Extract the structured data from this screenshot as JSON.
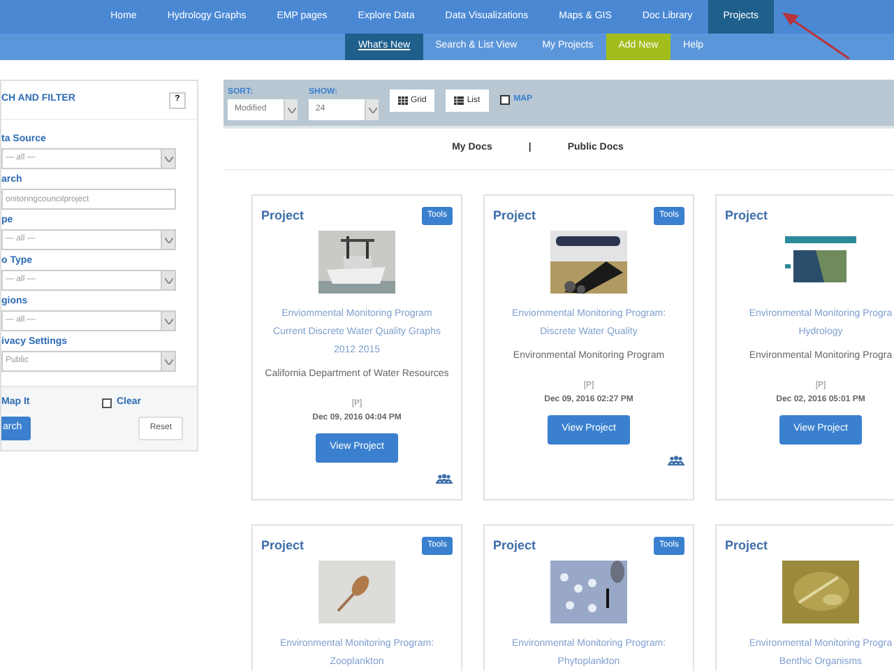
{
  "nav": [
    {
      "label": "Home",
      "selected": false
    },
    {
      "label": "Hydrology Graphs",
      "selected": false
    },
    {
      "label": "EMP pages",
      "selected": false
    },
    {
      "label": "Explore Data",
      "selected": false
    },
    {
      "label": "Data Visualizations",
      "selected": false
    },
    {
      "label": "Maps & GIS",
      "selected": false
    },
    {
      "label": "Doc Library",
      "selected": false
    },
    {
      "label": "Projects",
      "selected": true
    }
  ],
  "subnav": [
    {
      "label": "What's New",
      "selected": true,
      "kind": "link"
    },
    {
      "label": "Search & List View",
      "selected": false,
      "kind": "link"
    },
    {
      "label": "My Projects",
      "selected": false,
      "kind": "link"
    },
    {
      "label": "Add New",
      "selected": false,
      "kind": "highlight"
    },
    {
      "label": "Help",
      "selected": false,
      "kind": "link"
    }
  ],
  "sidebar": {
    "title": "CH AND FILTER",
    "help": "?",
    "fields": [
      {
        "label": "ta Source",
        "kind": "select",
        "value": "— all —"
      },
      {
        "label": "arch",
        "kind": "input",
        "value": "onitoringcouncilproject"
      },
      {
        "label": "pe",
        "kind": "select",
        "value": "— all —"
      },
      {
        "label": "o Type",
        "kind": "select",
        "value": "— all —"
      },
      {
        "label": "gions",
        "kind": "select",
        "value": "— all —"
      },
      {
        "label": "ivacy Settings",
        "kind": "select",
        "value": "Public"
      }
    ],
    "map_it": "Map It",
    "clear": {
      "label": "Clear",
      "checked": false
    },
    "search_button": "arch",
    "reset_button": "Reset"
  },
  "toolbar": {
    "sort_label": "SORT:",
    "sort_value": "Modified",
    "show_label": "SHOW:",
    "show_value": "24",
    "grid_button": "Grid",
    "list_button": "List",
    "map": {
      "label": "MAP",
      "checked": false
    }
  },
  "doc_tabs": [
    "My Docs",
    "|",
    "Public Docs"
  ],
  "cards": [
    {
      "type": "Project",
      "tools": "Tools",
      "title": "Enviommental Monitoring Program\nCurrent Discrete Water Quality Graphs\n2012 2015",
      "org": "California Department of Water Resources",
      "privacy": "[P]",
      "date": "Dec 09, 2016 04:04 PM",
      "button": "View Project",
      "shared": true
    },
    {
      "type": "Project",
      "tools": "Tools",
      "title": "Enviornmental Monitoring Program:\nDiscrete Water Quality",
      "org": "Environmental Monitoring Program",
      "privacy": "[P]",
      "date": "Dec 09, 2016 02:27 PM",
      "button": "View Project",
      "shared": true
    },
    {
      "type": "Project",
      "title": "Environmental Monitoring Progra\nHydrology",
      "org": "Environmental Monitoring Progra",
      "privacy": "[P]",
      "date": "Dec 02, 2016 05:01 PM",
      "button": "View Project"
    },
    {
      "type": "Project",
      "tools": "Tools",
      "title": "Environmental Monitoring Program:\nZooplankton"
    },
    {
      "type": "Project",
      "tools": "Tools",
      "title": "Environmental Monitoring Program:\nPhytoplankton"
    },
    {
      "type": "Project",
      "title": "Environmental Monitoring Progra\nBenthic Organisms"
    }
  ]
}
